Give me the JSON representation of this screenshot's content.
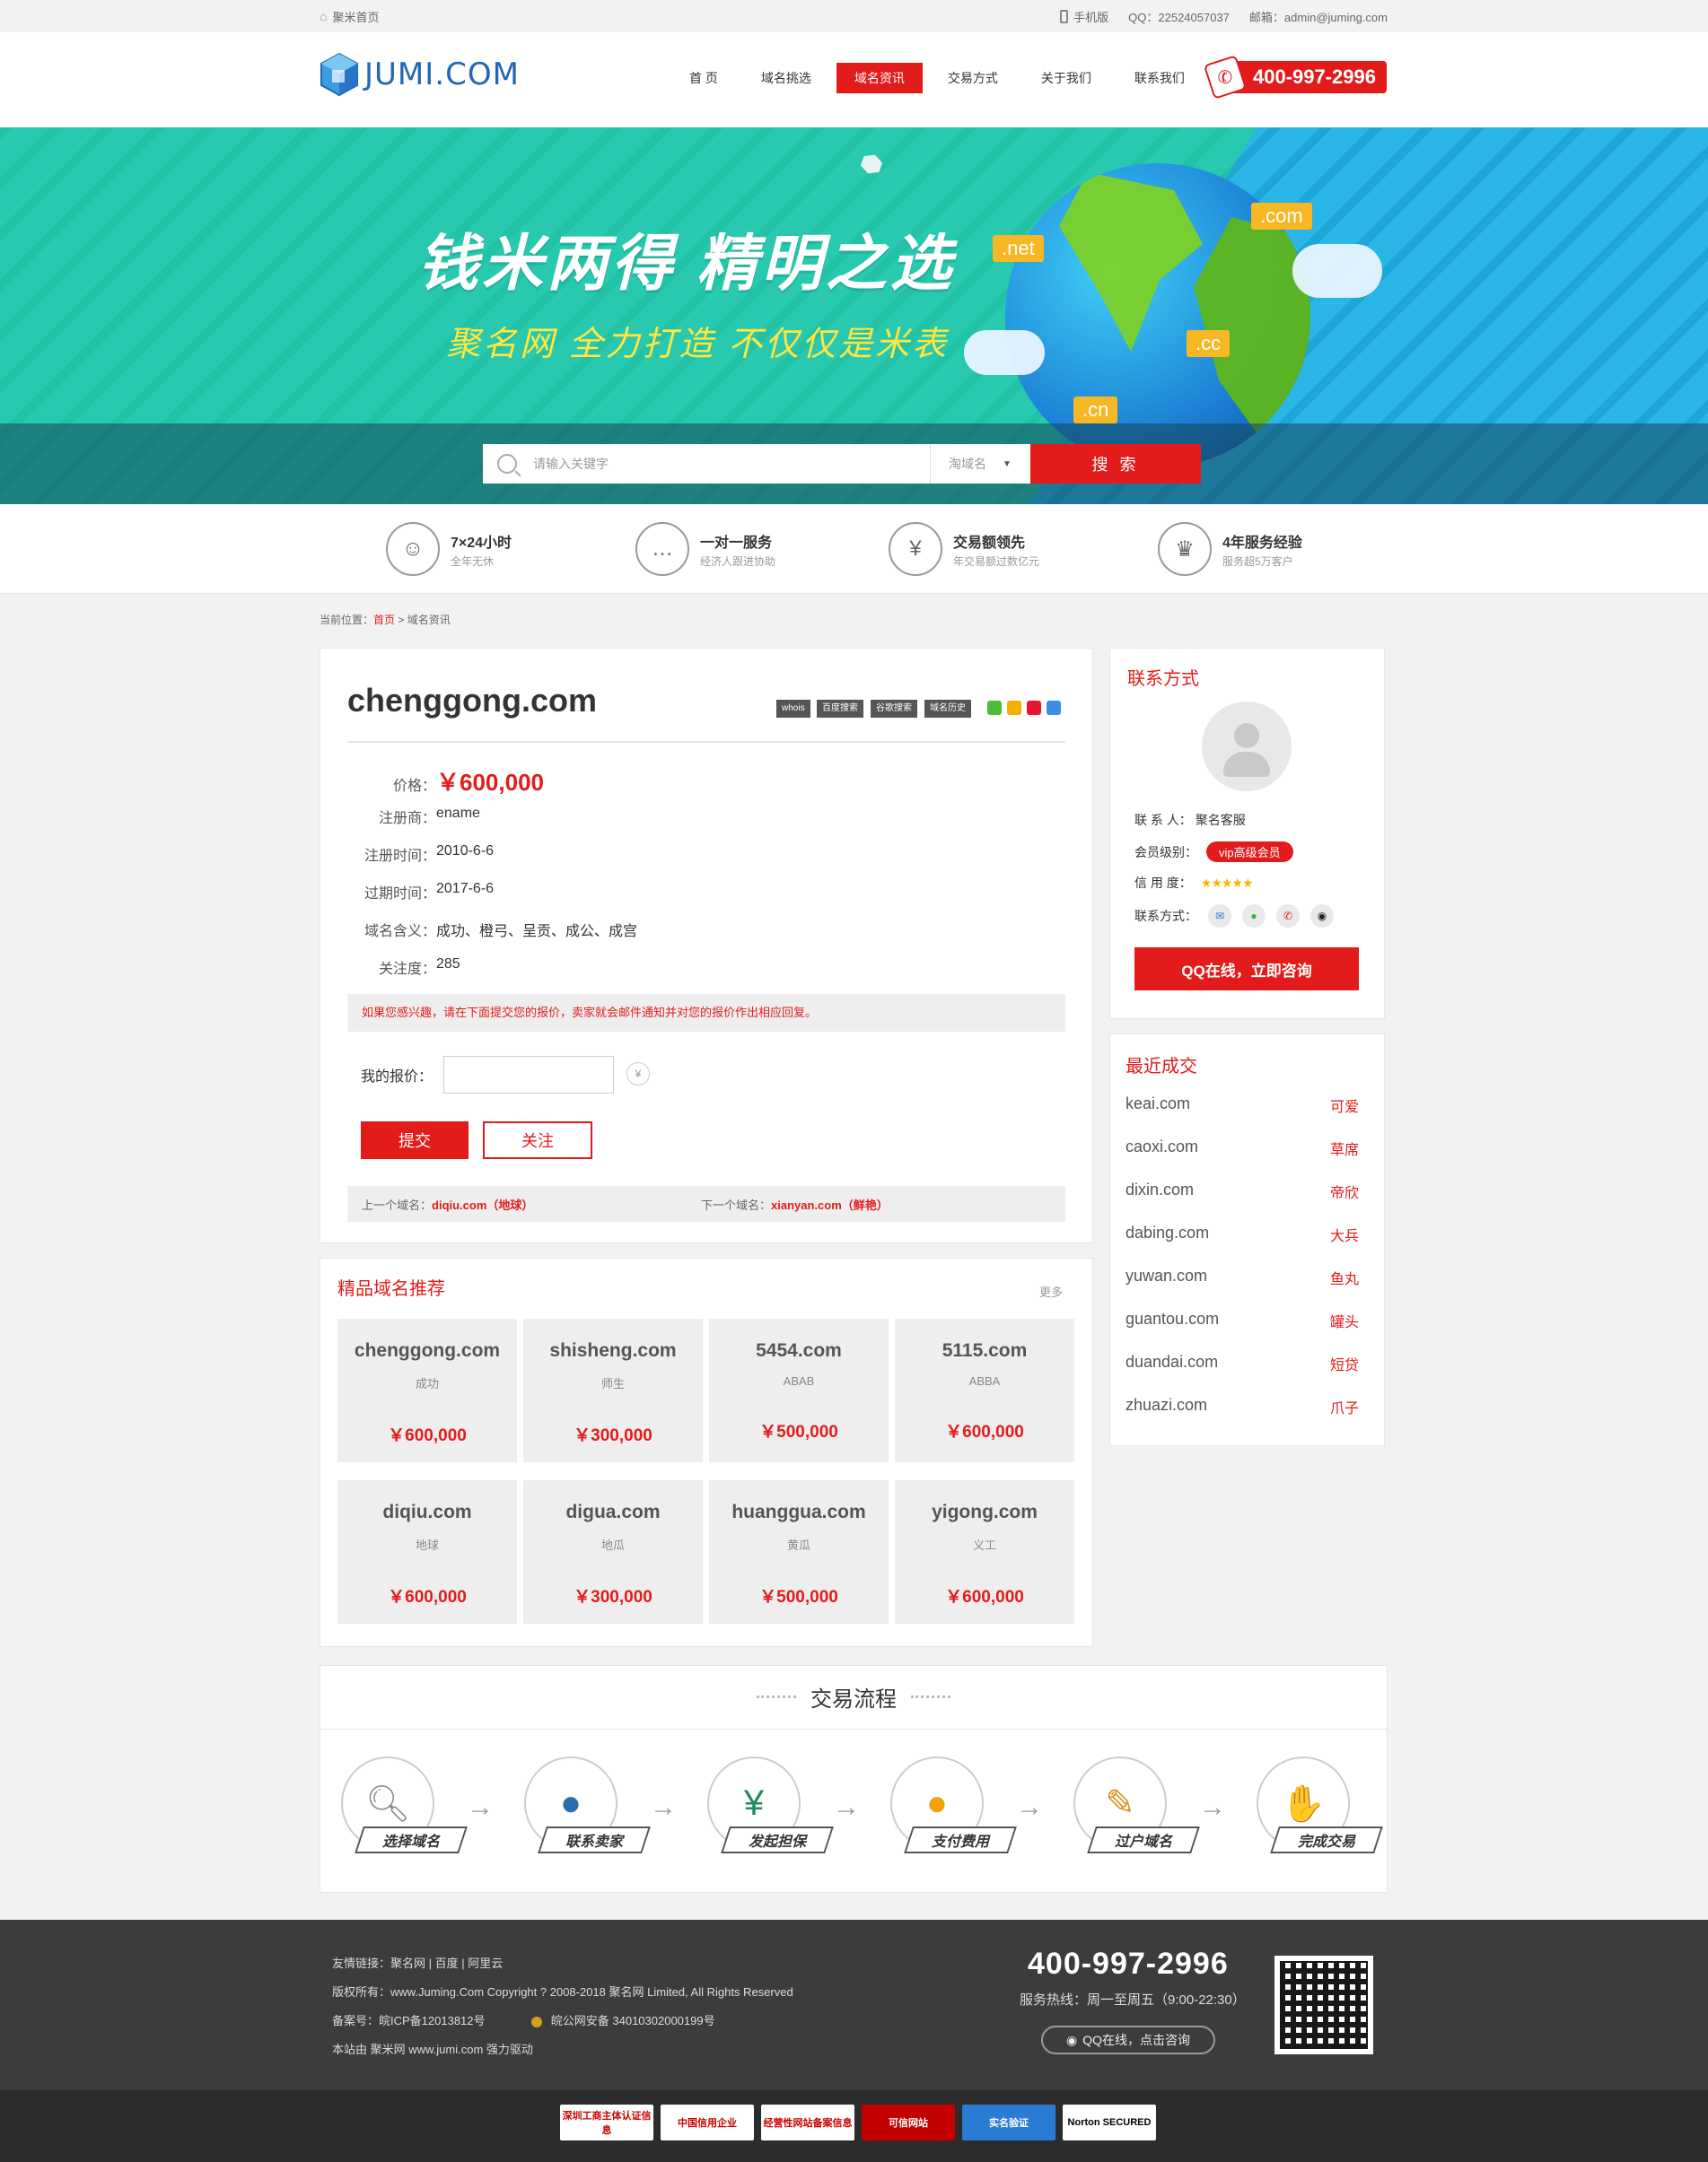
{
  "topbar": {
    "home": "聚米首页",
    "mobile": "手机版",
    "qq": "QQ：22524057037",
    "email": "邮箱：admin@juming.com"
  },
  "header": {
    "logo_text": "JUMI.COM",
    "nav": [
      "首 页",
      "域名挑选",
      "域名资讯",
      "交易方式",
      "关于我们",
      "联系我们"
    ],
    "active_nav": "域名资讯",
    "hotline": "400-997-2996"
  },
  "banner": {
    "slogan1": "钱米两得  精明之选",
    "slogan2": "聚名网  全力打造  不仅仅是米表",
    "tags": [
      ".net",
      ".com",
      ".cc",
      ".cn"
    ]
  },
  "search": {
    "placeholder": "请输入关键字",
    "type": "淘域名",
    "button": "搜 索"
  },
  "features": [
    {
      "title": "7×24小时",
      "sub": "全年无休",
      "icon": "headset-icon"
    },
    {
      "title": "一对一服务",
      "sub": "经济人跟进协助",
      "icon": "chat-icon"
    },
    {
      "title": "交易额领先",
      "sub": "年交易额过数亿元",
      "icon": "yen-icon"
    },
    {
      "title": "4年服务经验",
      "sub": "服务超5万客户",
      "icon": "trophy-icon"
    }
  ],
  "breadcrumb": {
    "prefix": "当前位置：",
    "home": "首页",
    "sep": " > ",
    "current": "域名资讯"
  },
  "detail": {
    "domain": "chenggong.com",
    "tools": [
      "whois",
      "百度搜索",
      "谷歌搜索",
      "域名历史"
    ],
    "price_label": "价格：",
    "price": "￥600,000",
    "rows": [
      {
        "k": "注册商：",
        "v": "ename"
      },
      {
        "k": "注册时间：",
        "v": "2010-6-6"
      },
      {
        "k": "过期时间：",
        "v": "2017-6-6"
      },
      {
        "k": "域名含义：",
        "v": "成功、橙弓、呈贡、成公、成宫"
      },
      {
        "k": "关注度：",
        "v": "285"
      }
    ],
    "notice": "如果您感兴趣，请在下面提交您的报价，卖家就会邮件通知并对您的报价作出相应回复。",
    "offer_label": "我的报价：",
    "yen": "¥",
    "submit": "提交",
    "follow": "关注",
    "prev_label": "上一个域名：",
    "prev_domain": "diqiu.com（地球）",
    "next_label": "下一个域名：",
    "next_domain": "xianyan.com（鲜艳）"
  },
  "recommend": {
    "title": "精品域名推荐",
    "more": "更多",
    "items": [
      {
        "domain": "chenggong.com",
        "meaning": "成功",
        "price": "￥600,000"
      },
      {
        "domain": "shisheng.com",
        "meaning": "师生",
        "price": "￥300,000"
      },
      {
        "domain": "5454.com",
        "meaning": "ABAB",
        "price": "￥500,000"
      },
      {
        "domain": "5115.com",
        "meaning": "ABBA",
        "price": "￥600,000"
      },
      {
        "domain": "diqiu.com",
        "meaning": "地球",
        "price": "￥600,000"
      },
      {
        "domain": "digua.com",
        "meaning": "地瓜",
        "price": "￥300,000"
      },
      {
        "domain": "huanggua.com",
        "meaning": "黄瓜",
        "price": "￥500,000"
      },
      {
        "domain": "yigong.com",
        "meaning": "义工",
        "price": "￥600,000"
      }
    ]
  },
  "contact": {
    "title": "联系方式",
    "person_label": "联  系  人：",
    "person": "聚名客服",
    "level_label": "会员级别：",
    "level": "vip高级会员",
    "credit_label": "信  用  度：",
    "stars": "★★★★★",
    "methods_label": "联系方式：",
    "qq_button": "QQ在线，立即咨询"
  },
  "recent": {
    "title": "最近成交",
    "deals": [
      {
        "domain": "keai.com",
        "meaning": "可爱"
      },
      {
        "domain": "caoxi.com",
        "meaning": "草席"
      },
      {
        "domain": "dixin.com",
        "meaning": "帝欣"
      },
      {
        "domain": "dabing.com",
        "meaning": "大兵"
      },
      {
        "domain": "yuwan.com",
        "meaning": "鱼丸"
      },
      {
        "domain": "guantou.com",
        "meaning": "罐头"
      },
      {
        "domain": "duandai.com",
        "meaning": "短贷"
      },
      {
        "domain": "zhuazi.com",
        "meaning": "爪子"
      }
    ]
  },
  "process": {
    "title": "交易流程",
    "steps": [
      "选择域名",
      "联系卖家",
      "发起担保",
      "支付费用",
      "过户域名",
      "完成交易"
    ]
  },
  "footer": {
    "links": "友情链接：聚名网 | 百度 | 阿里云",
    "copyright": "版权所有：www.Juming.Com    Copyright ? 2008-2018 聚名网 Limited, All Rights Reserved",
    "icp": "备案号：皖ICP备12013812号",
    "police": "皖公网安备 34010302000199号",
    "powered": "本站由 聚米网 www.jumi.com 强力驱动",
    "phone": "400-997-2996",
    "service": "服务热线：周一至周五（9:00-22:30）",
    "qq": "QQ在线，点击咨询",
    "badges": [
      "深圳工商主体认证信息",
      "中国信用企业",
      "经营性网站备案信息",
      "可信网站",
      "实名验证",
      "Norton SECURED"
    ]
  }
}
